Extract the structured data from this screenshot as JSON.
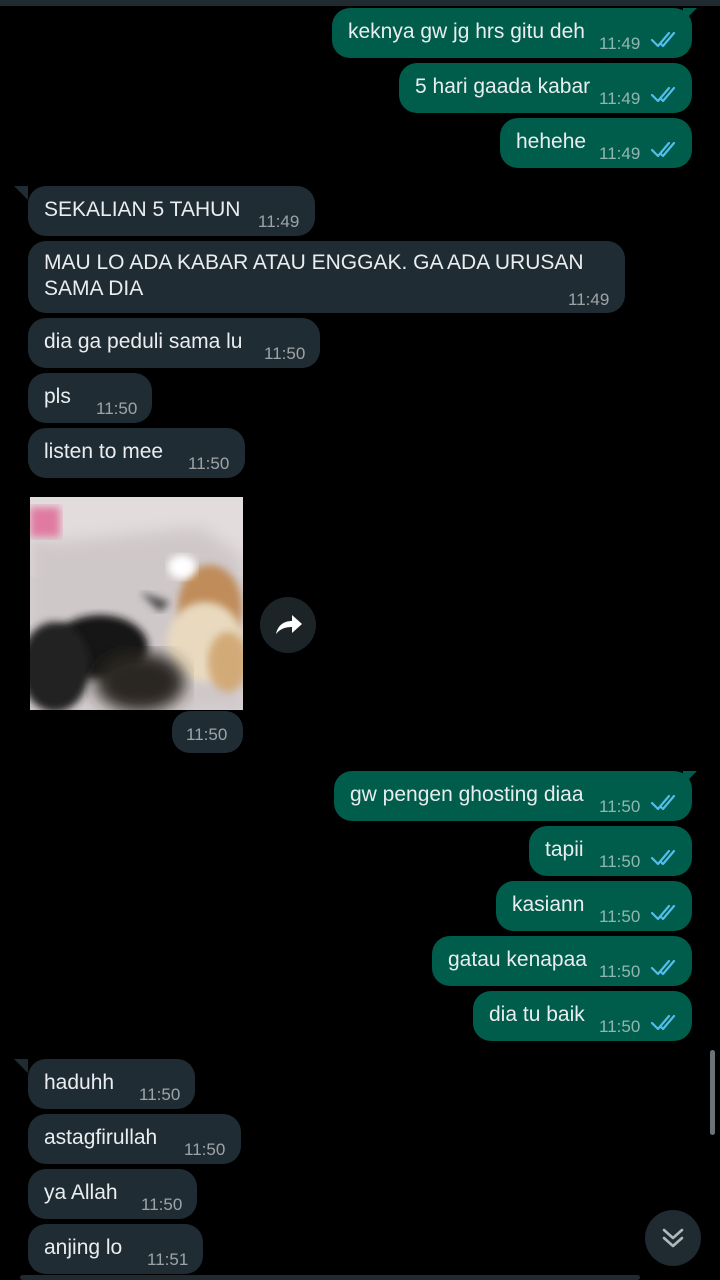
{
  "colors": {
    "background": "#000000",
    "outgoing_bubble": "#005c4b",
    "incoming_bubble": "#202c33",
    "text": "#e9edef",
    "read_ticks": "#53bdeb"
  },
  "messages": [
    {
      "text": "keknya gw jg hrs gitu deh",
      "time": "11:49",
      "direction": "outgoing",
      "status": "read"
    },
    {
      "text": "5 hari gaada kabar",
      "time": "11:49",
      "direction": "outgoing",
      "status": "read"
    },
    {
      "text": "hehehe",
      "time": "11:49",
      "direction": "outgoing",
      "status": "read"
    },
    {
      "text": "SEKALIAN 5 TAHUN",
      "time": "11:49",
      "direction": "incoming"
    },
    {
      "text_line1": "MAU LO ADA KABAR ATAU ENGGAK. GA ADA URUSAN",
      "text_line2": "SAMA DIA",
      "time": "11:49",
      "direction": "incoming"
    },
    {
      "text": "dia ga peduli sama lu",
      "time": "11:50",
      "direction": "incoming"
    },
    {
      "text": "pls",
      "time": "11:50",
      "direction": "incoming"
    },
    {
      "text": "listen to mee",
      "time": "11:50",
      "direction": "incoming"
    },
    {
      "media": "gif-image",
      "time": "11:50",
      "direction": "incoming"
    },
    {
      "text": "gw pengen ghosting diaa",
      "time": "11:50",
      "direction": "outgoing",
      "status": "read"
    },
    {
      "text": "tapii",
      "time": "11:50",
      "direction": "outgoing",
      "status": "read"
    },
    {
      "text": "kasiann",
      "time": "11:50",
      "direction": "outgoing",
      "status": "read"
    },
    {
      "text": "gatau kenapaa",
      "time": "11:50",
      "direction": "outgoing",
      "status": "read"
    },
    {
      "text": "dia tu baik",
      "time": "11:50",
      "direction": "outgoing",
      "status": "read"
    },
    {
      "text": "haduhh",
      "time": "11:50",
      "direction": "incoming"
    },
    {
      "text": "astagfirullah",
      "time": "11:50",
      "direction": "incoming"
    },
    {
      "text": "ya Allah",
      "time": "11:50",
      "direction": "incoming"
    },
    {
      "text": "anjing lo",
      "time": "11:51",
      "direction": "incoming"
    }
  ],
  "icons": {
    "forward": "forward-arrow-icon",
    "scroll_down": "double-chevron-down-icon",
    "read_receipt": "double-check-icon"
  }
}
